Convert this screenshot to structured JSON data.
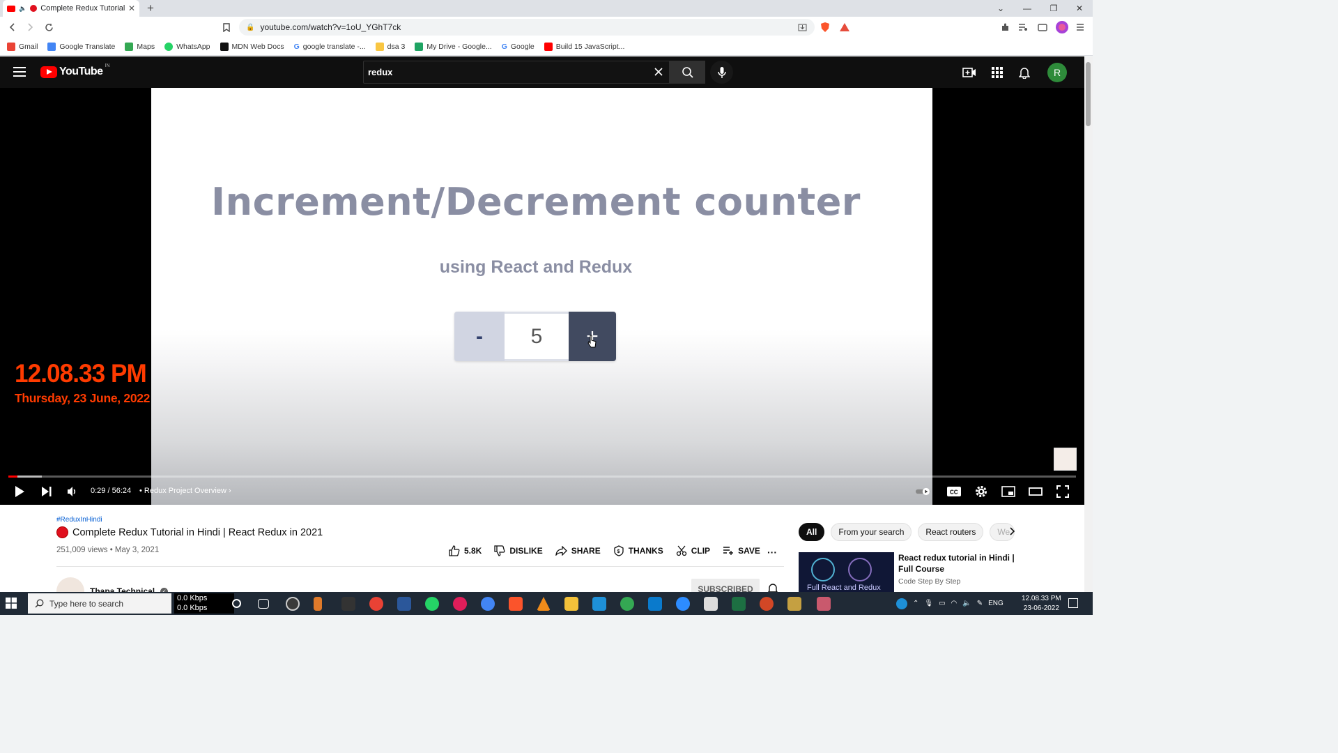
{
  "browser": {
    "tab_title": "Complete Redux Tutorial in Hindi",
    "url": "youtube.com/watch?v=1oU_YGhT7ck",
    "bookmarks": [
      {
        "label": "Gmail",
        "color": "#ea4335"
      },
      {
        "label": "Google Translate",
        "color": "#4285f4"
      },
      {
        "label": "Maps",
        "color": "#34a853"
      },
      {
        "label": "WhatsApp",
        "color": "#25d366"
      },
      {
        "label": "MDN Web Docs",
        "color": "#111111"
      },
      {
        "label": "google translate -...",
        "color": "#4285f4"
      },
      {
        "label": "dsa 3",
        "color": "#f9c642"
      },
      {
        "label": "My Drive - Google...",
        "color": "#1fa463"
      },
      {
        "label": "Google",
        "color": "#4285f4"
      },
      {
        "label": "Build 15 JavaScript...",
        "color": "#ff0000"
      }
    ]
  },
  "youtube": {
    "logo_text": "YouTube",
    "country_code": "IN",
    "search_query": "redux",
    "avatar_letter": "R",
    "accent_color": "#ff0000"
  },
  "video_content": {
    "heading": "Increment/Decrement counter",
    "subheading": "using React and Redux",
    "minus_label": "-",
    "counter_value": "5",
    "plus_label": "+"
  },
  "overlay_clock": {
    "time": "12.08.33 PM",
    "date": "Thursday, 23 June, 2022"
  },
  "player": {
    "timecode": "0:29 / 56:24",
    "chapter": "• Redux Project Overview",
    "progress_fraction": 0.0086
  },
  "video_info": {
    "hashtag": "#ReduxInHindi",
    "title": "Complete Redux Tutorial in Hindi | React Redux in 2021",
    "meta": "251,009 views • May 3, 2021",
    "likes": "5.8K",
    "dislike": "DISLIKE",
    "share": "SHARE",
    "thanks": "THANKS",
    "clip": "CLIP",
    "save": "SAVE",
    "channel": "Thapa Technical",
    "subscribe": "SUBSCRIBED"
  },
  "sidebar": {
    "chips": [
      "All",
      "From your search",
      "React routers",
      "We"
    ],
    "rec_title": "React redux tutorial in Hindi | Full Course",
    "rec_channel": "Code Step By Step",
    "rec_thumb_label": "Full React and Redux"
  },
  "taskbar": {
    "search_placeholder": "Type here to search",
    "net_up": "0.0 Kbps",
    "net_down": "0.0 Kbps",
    "language": "ENG",
    "time": "12.08.33 PM",
    "date": "23-06-2022"
  }
}
